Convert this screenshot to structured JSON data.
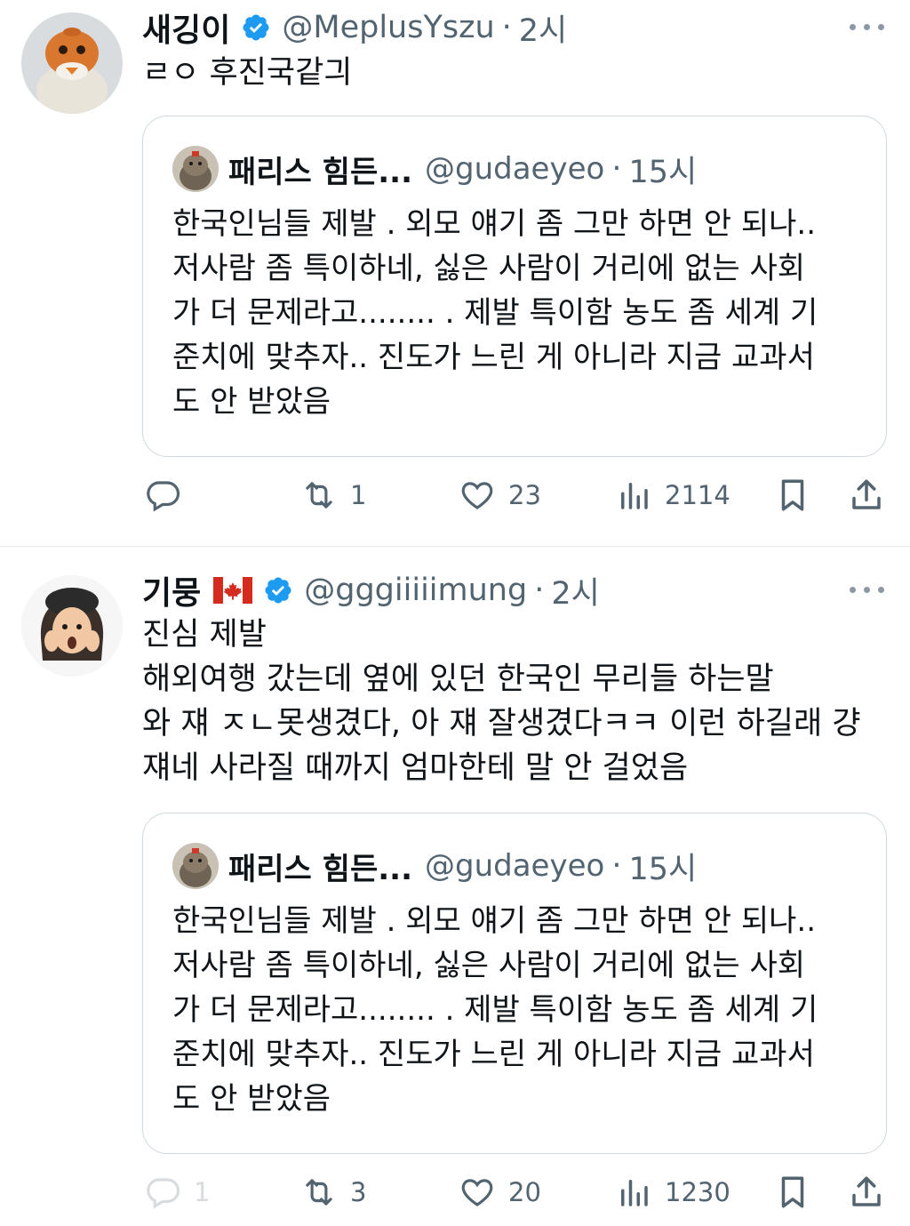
{
  "tweets": [
    {
      "name": "새깅이",
      "handle": "@MeplusYszu",
      "separator": "·",
      "time": "2시",
      "text": "ㄹㅇ 후진국같긔",
      "quote": {
        "name": "패리스 힘든...",
        "handle": "@gudaeyeo",
        "separator": "·",
        "time": "15시",
        "text": "한국인님들 제발 . 외모 얘기 좀 그만 하면 안 되나..\n저사람 좀 특이하네, 싫은 사람이 거리에 없는 사회\n가 더 문제라고........ . 제발 특이함 농도 좀 세계 기\n준치에 맞추자.. 진도가 느린 게 아니라 지금 교과서\n도 안 받았음"
      },
      "actions": {
        "replies": "",
        "retweets": "1",
        "likes": "23",
        "views": "2114"
      }
    },
    {
      "name": "기뭉",
      "handle": "@gggiiiiimung",
      "separator": "·",
      "time": "2시",
      "flag": "canada-flag-icon",
      "text": "진심 제발\n해외여행 갔는데 옆에 있던 한국인 무리들 하는말\n와 쟤 ㅈㄴ못생겼다, 아 쟤 잘생겼다ㅋㅋ 이런 하길래 걍\n쟤네 사라질 때까지 엄마한테 말 안 걸었음",
      "quote": {
        "name": "패리스 힘든...",
        "handle": "@gudaeyeo",
        "separator": "·",
        "time": "15시",
        "text": "한국인님들 제발 . 외모 얘기 좀 그만 하면 안 되나..\n저사람 좀 특이하네, 싫은 사람이 거리에 없는 사회\n가 더 문제라고........ . 제발 특이함 농도 좀 세계 기\n준치에 맞추자.. 진도가 느린 게 아니라 지금 교과서\n도 안 받았음"
      },
      "actions": {
        "replies": "1",
        "retweets": "3",
        "likes": "20",
        "views": "1230"
      }
    }
  ],
  "colors": {
    "text": "#0f1419",
    "secondary": "#536471",
    "verified": "#1d9bf0",
    "border": "#cfd9de",
    "divider": "#e1e6ea",
    "canada_red": "#d52b1e"
  },
  "icons": {
    "verified": "verified-badge-icon",
    "more": "more-dots-icon",
    "reply": "reply-icon",
    "retweet": "retweet-icon",
    "like": "heart-icon",
    "views": "views-chart-icon",
    "bookmark": "bookmark-icon",
    "share": "share-icon"
  }
}
